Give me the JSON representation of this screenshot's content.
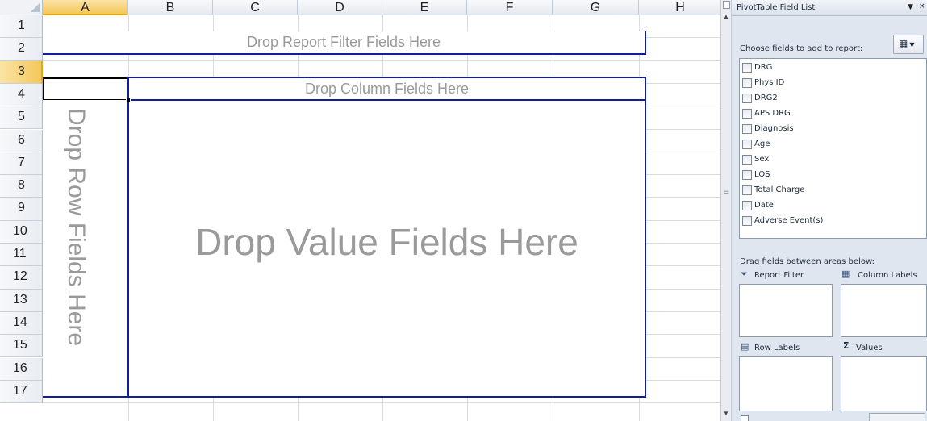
{
  "spreadsheet": {
    "columns": [
      "A",
      "B",
      "C",
      "D",
      "E",
      "F",
      "G",
      "H"
    ],
    "rows": [
      "1",
      "2",
      "3",
      "4",
      "5",
      "6",
      "7",
      "8",
      "9",
      "10",
      "11",
      "12",
      "13",
      "14",
      "15",
      "16",
      "17"
    ],
    "selected_column": "A",
    "selected_row": "3",
    "placeholders": {
      "report_filter": "Drop Report Filter Fields Here",
      "column": "Drop Column Fields Here",
      "row": "Drop Row Fields Here",
      "values": "Drop Value Fields Here"
    },
    "colors": {
      "zone_border": "#0f1f9c",
      "placeholder_text": "#9a9a9a",
      "selection": "#f4c75a"
    }
  },
  "field_list": {
    "title": "PivotTable Field List",
    "choose_label": "Choose fields to add to report:",
    "fields": [
      {
        "label": "DRG",
        "checked": false
      },
      {
        "label": "Phys ID",
        "checked": false
      },
      {
        "label": "DRG2",
        "checked": false
      },
      {
        "label": "APS DRG",
        "checked": false
      },
      {
        "label": "Diagnosis",
        "checked": false
      },
      {
        "label": "Age",
        "checked": false
      },
      {
        "label": "Sex",
        "checked": false
      },
      {
        "label": "LOS",
        "checked": false
      },
      {
        "label": "Total Charge",
        "checked": false
      },
      {
        "label": "Date",
        "checked": false
      },
      {
        "label": "Adverse Event(s)",
        "checked": false
      }
    ],
    "drag_label": "Drag fields between areas below:",
    "areas": {
      "report_filter": {
        "label": "Report Filter",
        "icon": "filter-icon"
      },
      "column_labels": {
        "label": "Column Labels",
        "icon": "column-grid-icon"
      },
      "row_labels": {
        "label": "Row Labels",
        "icon": "row-grid-icon"
      },
      "values": {
        "label": "Values",
        "icon": "sigma-icon"
      }
    }
  }
}
